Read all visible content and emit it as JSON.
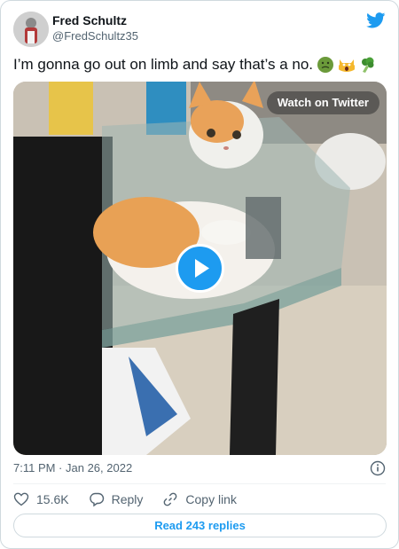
{
  "tweet": {
    "author_name": "Fred Schultz",
    "author_handle": "@FredSchultz35",
    "text": "I’m gonna go out on limb and say that’s a no.",
    "emojis": [
      "nauseated-face-emoji",
      "scream-cat-emoji",
      "broccoli-emoji"
    ]
  },
  "media": {
    "watch_label": "Watch on Twitter",
    "type": "video"
  },
  "meta": {
    "timestamp": "7:11 PM · Jan 26, 2022"
  },
  "actions": {
    "likes": "15.6K",
    "reply_label": "Reply",
    "copy_link_label": "Copy link"
  },
  "read_replies_label": "Read 243 replies",
  "colors": {
    "twitter_blue": "#1d9bf0",
    "text": "#0f1419",
    "secondary": "#536471",
    "border": "#cfd9de"
  }
}
